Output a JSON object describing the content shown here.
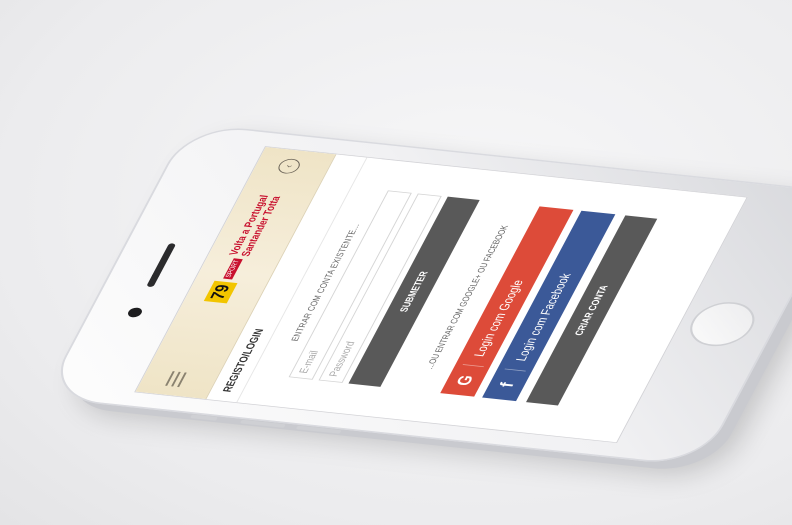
{
  "app": {
    "logo_number": "79",
    "logo_small": "SPORT",
    "logo_text": "Volta a Portugal Santander Totta",
    "page_title": "REGISTO/LOGIN"
  },
  "login": {
    "existing_label": "ENTRAR COM CONTA EXISTENTE...",
    "email_placeholder": "E-mail",
    "password_placeholder": "Password",
    "submit_label": "SUBMETER"
  },
  "social": {
    "or_label": "...OU ENTRAR COM GOOGLE+ OU FACEBOOK",
    "google_icon": "G",
    "google_label": "Login com Google",
    "facebook_icon": "f",
    "facebook_label": "Login com Facebook"
  },
  "register": {
    "create_label": "CRIAR CONTA"
  },
  "colors": {
    "google": "#dd4b39",
    "facebook": "#3b5998",
    "dark_button": "#595959",
    "header_bg": "#efe4c6"
  }
}
